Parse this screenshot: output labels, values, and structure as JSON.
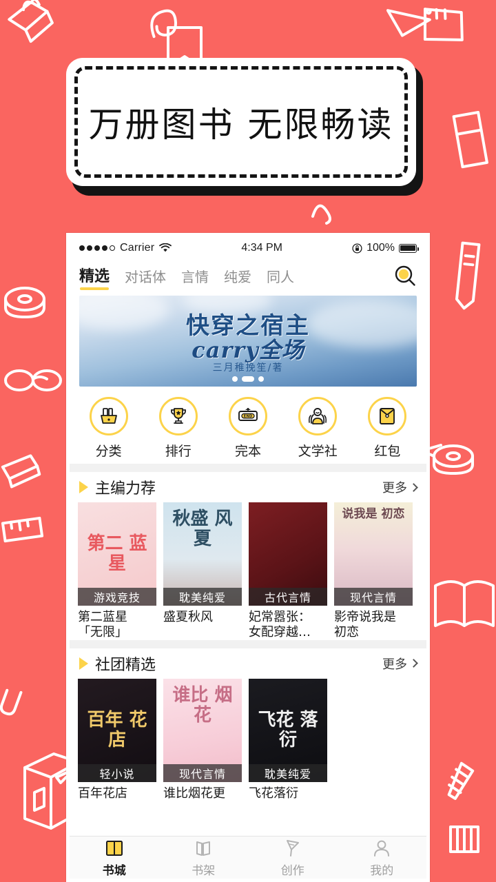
{
  "promo": {
    "headline": "万册图书  无限畅读",
    "background_color": "#fa6560",
    "accent_color": "#fcd34a"
  },
  "status_bar": {
    "carrier": "Carrier",
    "time": "4:34 PM",
    "battery_percent": "100%",
    "wifi_icon": "wifi-icon",
    "lock_icon": "rotation-lock-icon",
    "battery_icon": "battery-icon"
  },
  "tabs": [
    {
      "label": "精选",
      "active": true
    },
    {
      "label": "对话体",
      "active": false
    },
    {
      "label": "言情",
      "active": false
    },
    {
      "label": "纯爱",
      "active": false
    },
    {
      "label": "同人",
      "active": false
    }
  ],
  "search": {
    "icon": "search-icon"
  },
  "banner": {
    "title": "快穿之宿主",
    "subtitle": "carry全场",
    "author": "三月稚挽笙/著",
    "dots": 3,
    "active_dot": 2
  },
  "quick_links": [
    {
      "label": "分类",
      "icon": "basket-icon"
    },
    {
      "label": "排行",
      "icon": "trophy-icon"
    },
    {
      "label": "完本",
      "icon": "end-sign-icon"
    },
    {
      "label": "文学社",
      "icon": "people-icon"
    },
    {
      "label": "红包",
      "icon": "red-envelope-icon"
    }
  ],
  "sections": [
    {
      "title": "主编力荐",
      "more_label": "更多",
      "books": [
        {
          "title": "第二蓝星\n「无限」",
          "badge": "游戏竞技",
          "cover_text": "第二\n蓝星",
          "cover_bg": "linear-gradient(160deg,#f8dfe0,#f5c9cb)",
          "cover_fg": "#e8595f"
        },
        {
          "title": "盛夏秋风",
          "badge": "耽美纯爱",
          "cover_text": "秋盛\n风夏",
          "cover_bg": "linear-gradient(180deg,#cfe3ee 0%,#dfe9ef 55%,#c9b5b0 100%)",
          "cover_fg": "#2e4f63"
        },
        {
          "title": "妃常嚣张：\n女配穿越…",
          "badge": "古代言情",
          "cover_text": "",
          "cover_bg": "linear-gradient(150deg,#7d1e22,#5a1317 60%,#3b0c0f)",
          "cover_fg": "#f2d9a8"
        },
        {
          "title": "影帝说我是\n初恋",
          "badge": "现代言情",
          "cover_text": "说我是\n初恋",
          "cover_bg": "linear-gradient(180deg,#f4efd8 0%,#f0d9da 45%,#d9b8c4 100%)",
          "cover_fg": "#6e4a52"
        }
      ]
    },
    {
      "title": "社团精选",
      "more_label": "更多",
      "books": [
        {
          "title": "百年花店",
          "badge": "轻小说",
          "cover_text": "百年\n花店",
          "cover_bg": "linear-gradient(160deg,#231a20,#120d12)",
          "cover_fg": "#f0c96a"
        },
        {
          "title": "谁比烟花更",
          "badge": "现代言情",
          "cover_text": "谁比\n烟花",
          "cover_bg": "linear-gradient(170deg,#fbe1e8,#f7cdd8 60%,#f2bcc9)",
          "cover_fg": "#c66e86"
        },
        {
          "title": "飞花落衍",
          "badge": "耽美纯爱",
          "cover_text": "飞花\n落衍",
          "cover_bg": "linear-gradient(165deg,#1b1b20,#0d0d11)",
          "cover_fg": "#f0f0f0"
        }
      ]
    }
  ],
  "bottom_nav": [
    {
      "label": "书城",
      "icon": "bookstore-icon",
      "active": true
    },
    {
      "label": "书架",
      "icon": "bookshelf-icon",
      "active": false
    },
    {
      "label": "创作",
      "icon": "pen-icon",
      "active": false
    },
    {
      "label": "我的",
      "icon": "person-icon",
      "active": false
    }
  ]
}
